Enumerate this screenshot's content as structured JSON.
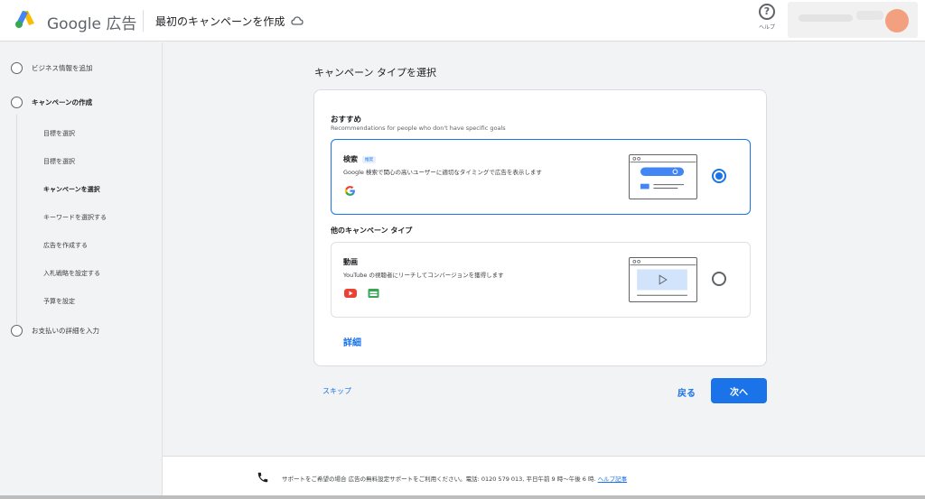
{
  "header": {
    "brand": "Google 広告",
    "page_title": "最初のキャンペーンを作成",
    "help_label": "ヘルプ"
  },
  "sidebar": {
    "steps": [
      {
        "label": "ビジネス情報を追加"
      },
      {
        "label": "キャンペーンの作成"
      },
      {
        "label": "お支払いの詳細を入力"
      }
    ],
    "substeps": [
      {
        "label": "目標を選択"
      },
      {
        "label": "目標を選択"
      },
      {
        "label": "キャンペーンを選択"
      },
      {
        "label": "キーワードを選択する"
      },
      {
        "label": "広告を作成する"
      },
      {
        "label": "入札戦略を設定する"
      },
      {
        "label": "予算を設定"
      }
    ]
  },
  "main": {
    "section_title": "キャンペーン タイプを選択",
    "recommended_title": "おすすめ",
    "recommended_subtitle": "Recommendations for people who don't have specific goals",
    "search_option": {
      "title": "検索",
      "badge": "推奨",
      "description": "Google 検索で関心の高いユーザーに適切なタイミングで広告を表示します",
      "selected": true
    },
    "other_title": "他のキャンペーン タイプ",
    "video_option": {
      "title": "動画",
      "description": "YouTube の視聴者にリーチしてコンバージョンを獲得します",
      "selected": false
    },
    "details_link": "詳細",
    "skip_link": "スキップ",
    "back_label": "戻る",
    "next_label": "次へ"
  },
  "footer": {
    "text": "サポートをご希望の場合 広告の無料設定サポートをご利用ください。電話: 0120 579 013, 平日午前 9 時～午後 6 時.",
    "link": "ヘルプ記事"
  },
  "colors": {
    "accent": "#1a73e8",
    "background": "#f1f3f4"
  }
}
